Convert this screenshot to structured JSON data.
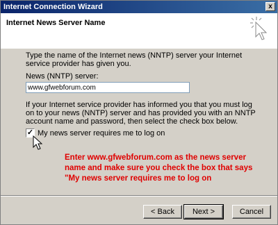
{
  "window": {
    "title": "Internet Connection Wizard",
    "close_glyph": "x"
  },
  "header": {
    "heading": "Internet News Server Name"
  },
  "body": {
    "intro": "Type the name of the Internet news (NNTP) server your Internet service provider has given you.",
    "field_label": "News (NNTP) server:",
    "server_value": "www.gfwebforum.com",
    "note": "If your Internet service provider has informed you that you must log on to your news (NNTP) server and has provided you with an NNTP account name and password, then select the check box below.",
    "checkbox_mark": "✓",
    "checkbox_label": "My news server requires me to log on",
    "checkbox_checked": true
  },
  "annotation": {
    "text": "Enter www.gfwebforum.com as the news server name and make sure you check the box that says \"My news server requires me to log on",
    "color": "#e00000"
  },
  "buttons": {
    "back": "< Back",
    "next": "Next >",
    "cancel": "Cancel"
  },
  "colors": {
    "titlebar_start": "#0a246a",
    "titlebar_end": "#3a6ea5",
    "dialog_bg": "#d4d0c8"
  }
}
